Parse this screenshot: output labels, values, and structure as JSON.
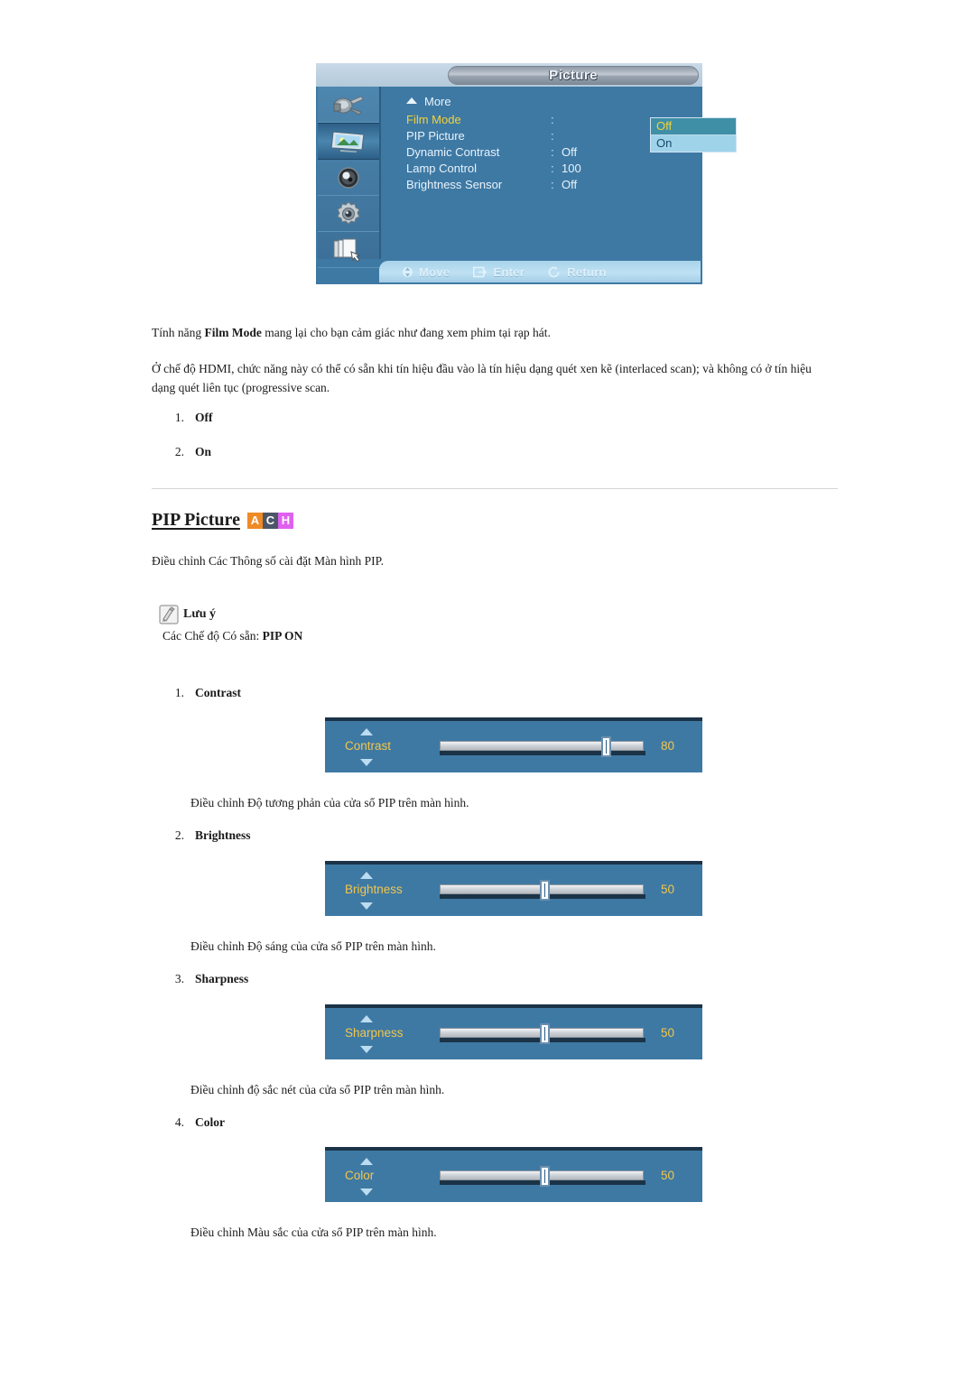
{
  "osd": {
    "title": "Picture",
    "more_label": "More",
    "sidebar_icons": [
      "input-source-icon",
      "picture-icon",
      "sound-icon",
      "setup-icon",
      "multi-control-icon"
    ],
    "selected_sidebar_index": 1,
    "rows": [
      {
        "label": "Film Mode",
        "value": "",
        "highlighted": true
      },
      {
        "label": "PIP Picture",
        "value": "",
        "highlighted": false
      },
      {
        "label": "Dynamic Contrast",
        "value": "Off",
        "highlighted": false
      },
      {
        "label": "Lamp Control",
        "value": "100",
        "highlighted": false
      },
      {
        "label": "Brightness Sensor",
        "value": "Off",
        "highlighted": false
      }
    ],
    "dropdown": {
      "options": [
        "Off",
        "On"
      ],
      "selected": "Off"
    },
    "footer": [
      {
        "icon": "updown-arrow-icon",
        "label": "Move"
      },
      {
        "icon": "enter-icon",
        "label": "Enter"
      },
      {
        "icon": "return-icon",
        "label": "Return"
      }
    ],
    "colors": {
      "panel_blue": "#3e79a4",
      "highlight_yellow": "#f2d23c",
      "dropdown_selected_bg": "#3f8fa6",
      "dropdown_option_bg": "#9fd3ea"
    }
  },
  "body": {
    "para1_pre": "Tính năng ",
    "para1_bold": "Film Mode",
    "para1_post": " mang lại cho bạn cảm giác như đang xem phim tại rạp hát.",
    "para2": "Ở chế độ HDMI, chức năng này có thể có sẵn khi tín hiệu đầu vào là tín hiệu dạng quét xen kẽ (interlaced scan); và không có ở tín hiệu dạng quét liên tục (progressive scan.",
    "filmmode_options": [
      {
        "num": "1.",
        "label": "Off"
      },
      {
        "num": "2.",
        "label": "On"
      }
    ]
  },
  "section": {
    "heading": "PIP Picture",
    "badges": [
      {
        "letter": "A",
        "color": "#f08a26"
      },
      {
        "letter": "C",
        "color": "#4c5667"
      },
      {
        "letter": "H",
        "color": "#e060f0"
      }
    ],
    "intro": "Điều chỉnh Các Thông số cài đặt Màn hình PIP.",
    "note": {
      "icon": "note-pencil-icon",
      "title": "Lưu ý",
      "text_pre": "Các Chế độ Có sẵn: ",
      "text_bold": "PIP ON"
    },
    "items": [
      {
        "num": "1.",
        "title": "Contrast",
        "slider": {
          "label": "Contrast",
          "value": "80",
          "percent": 80
        },
        "caption": "Điều chỉnh Độ tương phản của cửa sổ PIP trên màn hình."
      },
      {
        "num": "2.",
        "title": "Brightness",
        "slider": {
          "label": "Brightness",
          "value": "50",
          "percent": 50
        },
        "caption": "Điều chỉnh Độ sáng của cửa sổ PIP trên màn hình."
      },
      {
        "num": "3.",
        "title": "Sharpness",
        "slider": {
          "label": "Sharpness",
          "value": "50",
          "percent": 50
        },
        "caption": "Điều chỉnh độ sắc nét của cửa sổ PIP trên màn hình."
      },
      {
        "num": "4.",
        "title": "Color",
        "slider": {
          "label": "Color",
          "value": "50",
          "percent": 50
        },
        "caption": "Điều chỉnh Màu sắc của cửa sổ PIP trên màn hình."
      }
    ]
  }
}
